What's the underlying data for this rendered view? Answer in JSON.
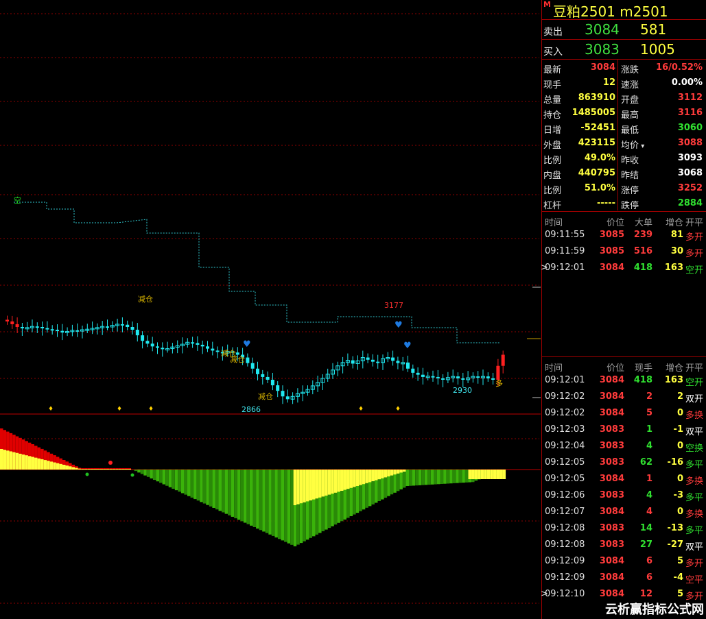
{
  "header": {
    "market_flag": "M",
    "title": "豆粕2501  m2501"
  },
  "quote": {
    "sell": {
      "label": "卖出",
      "price": "3084",
      "volume": "581"
    },
    "buy": {
      "label": "买入",
      "price": "3083",
      "volume": "1005"
    }
  },
  "stats": [
    {
      "l1": "最新",
      "v1": "3084",
      "c1": "red",
      "l2": "涨跌",
      "v2": "16/0.52%",
      "c2": "red"
    },
    {
      "l1": "现手",
      "v1": "12",
      "c1": "yellow",
      "l2": "速涨",
      "v2": "0.00%",
      "c2": "white"
    },
    {
      "l1": "总量",
      "v1": "863910",
      "c1": "yellow",
      "l2": "开盘",
      "v2": "3112",
      "c2": "red"
    },
    {
      "l1": "持仓",
      "v1": "1485005",
      "c1": "yellow",
      "l2": "最高",
      "v2": "3116",
      "c2": "red"
    },
    {
      "l1": "日增",
      "v1": "-52451",
      "c1": "yellow",
      "l2": "最低",
      "v2": "3060",
      "c2": "green"
    },
    {
      "l1": "外盘",
      "v1": "423115",
      "c1": "yellow",
      "l2": "均价",
      "v2": "3088",
      "c2": "red"
    },
    {
      "l1": "比例",
      "v1": "49.0%",
      "c1": "yellow",
      "l2": "昨收",
      "v2": "3093",
      "c2": "white"
    },
    {
      "l1": "内盘",
      "v1": "440795",
      "c1": "yellow",
      "l2": "昨结",
      "v2": "3068",
      "c2": "white"
    },
    {
      "l1": "比例",
      "v1": "51.0%",
      "c1": "yellow",
      "l2": "涨停",
      "v2": "3252",
      "c2": "red"
    },
    {
      "l1": "杠杆",
      "v1": "-----",
      "c1": "yellow",
      "l2": "跌停",
      "v2": "2884",
      "c2": "green"
    }
  ],
  "big_orders": {
    "headers": [
      "时间",
      "价位",
      "大单",
      "增仓",
      "开平"
    ],
    "rows": [
      {
        "time": "09:11:55",
        "price": "3085",
        "vol": "239",
        "inc": "81",
        "type": "多开",
        "pc": "red",
        "vc": "red",
        "ic": "yellow",
        "tc": "red",
        "mark": ""
      },
      {
        "time": "09:11:59",
        "price": "3085",
        "vol": "516",
        "inc": "30",
        "type": "多开",
        "pc": "red",
        "vc": "red",
        "ic": "yellow",
        "tc": "red",
        "mark": ""
      },
      {
        "time": "09:12:01",
        "price": "3084",
        "vol": "418",
        "inc": "163",
        "type": "空开",
        "pc": "red",
        "vc": "green",
        "ic": "yellow",
        "tc": "green",
        "mark": ">"
      }
    ]
  },
  "ticks": {
    "headers": [
      "时间",
      "价位",
      "现手",
      "增仓",
      "开平"
    ],
    "rows": [
      {
        "time": "09:12:01",
        "price": "3084",
        "vol": "418",
        "inc": "163",
        "type": "空开",
        "pc": "red",
        "vc": "green",
        "ic": "yellow",
        "tc": "green",
        "mark": ""
      },
      {
        "time": "09:12:02",
        "price": "3084",
        "vol": "2",
        "inc": "2",
        "type": "双开",
        "pc": "red",
        "vc": "red",
        "ic": "yellow",
        "tc": "white",
        "mark": ""
      },
      {
        "time": "09:12:02",
        "price": "3084",
        "vol": "5",
        "inc": "0",
        "type": "多换",
        "pc": "red",
        "vc": "red",
        "ic": "yellow",
        "tc": "red",
        "mark": ""
      },
      {
        "time": "09:12:03",
        "price": "3083",
        "vol": "1",
        "inc": "-1",
        "type": "双平",
        "pc": "red",
        "vc": "green",
        "ic": "yellow",
        "tc": "white",
        "mark": ""
      },
      {
        "time": "09:12:04",
        "price": "3083",
        "vol": "4",
        "inc": "0",
        "type": "空换",
        "pc": "red",
        "vc": "green",
        "ic": "yellow",
        "tc": "green",
        "mark": ""
      },
      {
        "time": "09:12:05",
        "price": "3083",
        "vol": "62",
        "inc": "-16",
        "type": "多平",
        "pc": "red",
        "vc": "green",
        "ic": "yellow",
        "tc": "green",
        "mark": ""
      },
      {
        "time": "09:12:05",
        "price": "3084",
        "vol": "1",
        "inc": "0",
        "type": "多换",
        "pc": "red",
        "vc": "red",
        "ic": "yellow",
        "tc": "red",
        "mark": ""
      },
      {
        "time": "09:12:06",
        "price": "3083",
        "vol": "4",
        "inc": "-3",
        "type": "多平",
        "pc": "red",
        "vc": "green",
        "ic": "yellow",
        "tc": "green",
        "mark": ""
      },
      {
        "time": "09:12:07",
        "price": "3084",
        "vol": "4",
        "inc": "0",
        "type": "多换",
        "pc": "red",
        "vc": "red",
        "ic": "yellow",
        "tc": "red",
        "mark": ""
      },
      {
        "time": "09:12:08",
        "price": "3083",
        "vol": "14",
        "inc": "-13",
        "type": "多平",
        "pc": "red",
        "vc": "green",
        "ic": "yellow",
        "tc": "green",
        "mark": ""
      },
      {
        "time": "09:12:08",
        "price": "3083",
        "vol": "27",
        "inc": "-27",
        "type": "双平",
        "pc": "red",
        "vc": "green",
        "ic": "yellow",
        "tc": "white",
        "mark": ""
      },
      {
        "time": "09:12:09",
        "price": "3084",
        "vol": "6",
        "inc": "5",
        "type": "多开",
        "pc": "red",
        "vc": "red",
        "ic": "yellow",
        "tc": "red",
        "mark": ""
      },
      {
        "time": "09:12:09",
        "price": "3084",
        "vol": "6",
        "inc": "-4",
        "type": "空平",
        "pc": "red",
        "vc": "red",
        "ic": "yellow",
        "tc": "red",
        "mark": ""
      },
      {
        "time": "09:12:10",
        "price": "3084",
        "vol": "12",
        "inc": "5",
        "type": "多开",
        "pc": "red",
        "vc": "red",
        "ic": "yellow",
        "tc": "red",
        "mark": ">"
      }
    ]
  },
  "chart_annotations": {
    "kong": "空",
    "jiancang": "减仓",
    "high": "3177",
    "low1": "2866",
    "low2": "2930",
    "duo": "多"
  },
  "chart_data": {
    "type": "candlestick",
    "price_levels": {
      "high": 3177,
      "low": 2866,
      "recent_low": 2930
    },
    "closes": [
      3160,
      3150,
      3140,
      3135,
      3138,
      3142,
      3140,
      3136,
      3132,
      3130,
      3126,
      3120,
      3124,
      3128,
      3126,
      3130,
      3132,
      3135,
      3138,
      3142,
      3140,
      3146,
      3150,
      3148,
      3140,
      3130,
      3110,
      3090,
      3080,
      3070,
      3065,
      3060,
      3062,
      3068,
      3072,
      3078,
      3085,
      3082,
      3076,
      3070,
      3062,
      3055,
      3050,
      3046,
      3052,
      3048,
      3040,
      3030,
      3010,
      2990,
      2970,
      2960,
      2950,
      2930,
      2910,
      2890,
      2880,
      2890,
      2900,
      2905,
      2915,
      2928,
      2940,
      2955,
      2970,
      2985,
      3000,
      3012,
      3020,
      3008,
      3018,
      3030,
      3022,
      3015,
      3012,
      3026,
      3030,
      3018,
      3010,
      3012,
      2990,
      2975,
      2968,
      2960,
      2963,
      2960,
      2955,
      2950,
      2958,
      2962,
      2955,
      2950,
      2957,
      2962,
      2958,
      2962,
      2955,
      2950,
      3000,
      3040
    ]
  }
}
